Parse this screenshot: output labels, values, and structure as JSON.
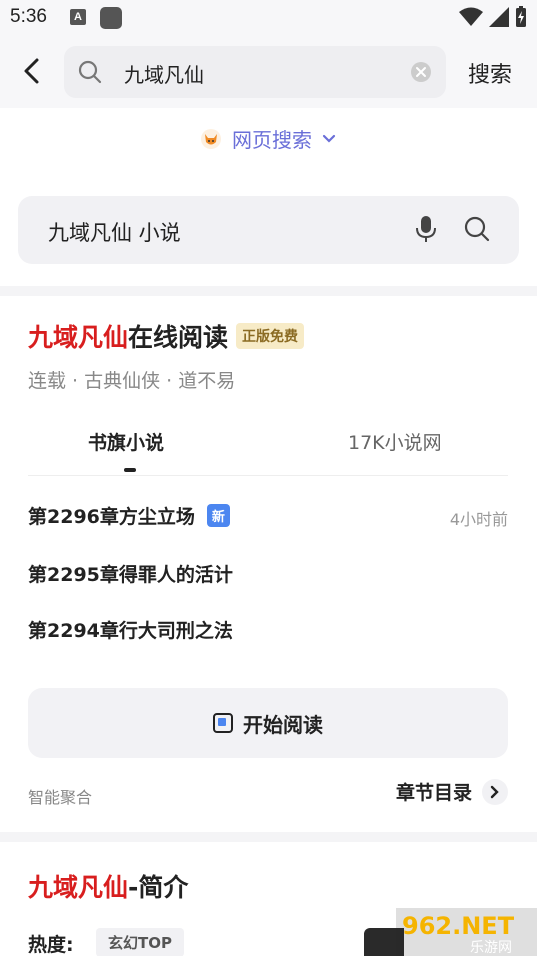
{
  "status": {
    "time": "5:36",
    "notif_letter": "A"
  },
  "search": {
    "query": "九域凡仙",
    "button": "搜索"
  },
  "web_search": {
    "label": "网页搜索"
  },
  "suggestion": {
    "query": "九域凡仙 小说"
  },
  "novel": {
    "title_red": "九域凡仙",
    "title_rest": "在线阅读",
    "badge": "正版免费",
    "meta": "连载 · 古典仙侠 · 道不易",
    "tabs": [
      "书旗小说",
      "17K小说网"
    ],
    "chapters": [
      {
        "title": "第2296章方尘立场",
        "badge": "新",
        "time": "4小时前"
      },
      {
        "title": "第2295章得罪人的活计"
      },
      {
        "title": "第2294章行大司刑之法"
      }
    ],
    "read_button": "开始阅读",
    "footer_left": "智能聚合",
    "footer_right": "章节目录"
  },
  "intro": {
    "title_red": "九域凡仙",
    "title_rest": "-简介",
    "heat_label": "热度:",
    "heat_tag": "玄幻TOP"
  },
  "watermark": {
    "text": "962.NET",
    "sub": "乐游网"
  },
  "colors": {
    "accent": "#6a6fd8",
    "red": "#d81e1e",
    "new_badge": "#4c86f0"
  }
}
